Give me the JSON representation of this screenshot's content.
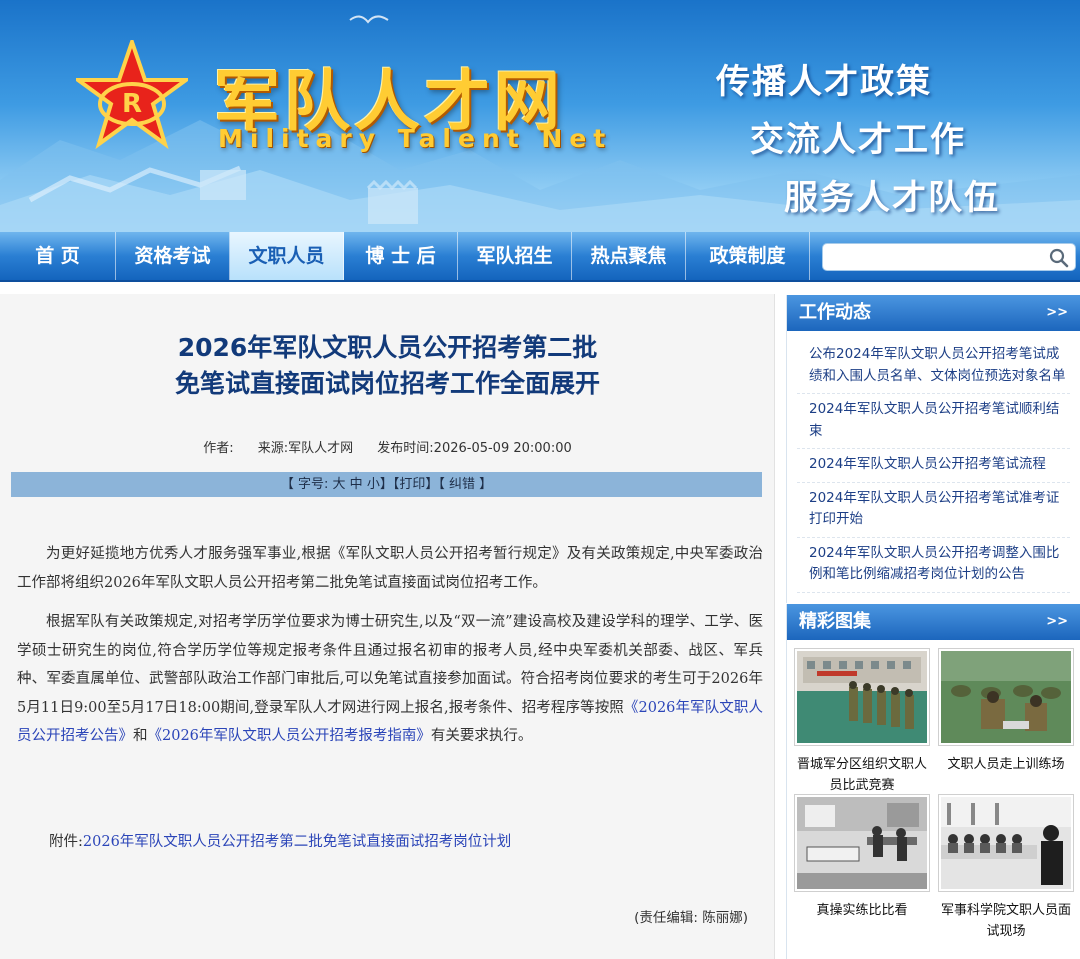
{
  "header": {
    "site_title": "军队人才网",
    "site_subtitle": "Military Talent Net",
    "slogans": [
      "传播人才政策",
      "交流人才工作",
      "服务人才队伍"
    ],
    "colors": {
      "banner": "#3e9be3",
      "title_gold": "#ffcc33",
      "nav": "#2a7fd3",
      "active_tab": "#b9e1fb"
    }
  },
  "nav": {
    "items": [
      {
        "label": "首  页"
      },
      {
        "label": "资格考试"
      },
      {
        "label": "文职人员"
      },
      {
        "label": "博 士 后"
      },
      {
        "label": "军队招生"
      },
      {
        "label": "热点聚焦"
      },
      {
        "label": "政策制度"
      }
    ],
    "active": "文职人员",
    "search": {
      "value": "",
      "placeholder": "",
      "icon": "search-icon"
    }
  },
  "article": {
    "title_line1": "2026年军队文职人员公开招考第二批",
    "title_line2": "免笔试直接面试岗位招考工作全面展开",
    "author_label": "作者:",
    "source": "来源:军队人才网",
    "publish_time": "发布时间:2026-05-09 20:00:00",
    "toolbar": {
      "font_label": "【 字号: ",
      "size_big": "大",
      "size_mid": "中",
      "size_small": "小",
      "font_close": "】",
      "print": "【打印】",
      "correct": "【 纠错 】"
    },
    "p1": "为更好延揽地方优秀人才服务强军事业,根据《军队文职人员公开招考暂行规定》及有关政策规定,中央军委政治工作部将组织2026年军队文职人员公开招考第二批免笔试直接面试岗位招考工作。",
    "p2_text": "根据军队有关政策规定,对招考学历学位要求为博士研究生,以及“双一流”建设高校及建设学科的理学、工学、医学硕士研究生的岗位,符合学历学位等规定报考条件且通过报名初审的报考人员,经中央军委机关部委、战区、军兵种、军委直属单位、武警部队政治工作部门审批后,可以免笔试直接参加面试。符合招考岗位要求的考生可于2026年5月11日9:00至5月17日18:00期间,登录军队人才网进行网上报名,报考条件、招考程序等按照",
    "p2_link1": "《2026年军队文职人员公开招考公告》",
    "p2_and": "和",
    "p2_link2": "《2026年军队文职人员公开招考报考指南》",
    "p2_tail": "有关要求执行。",
    "attach_label": "附件:",
    "attach_link": "2026年军队文职人员公开招考第二批免笔试直接面试招考岗位计划",
    "editor": "(责任编辑: 陈丽娜)"
  },
  "sidebar": {
    "news": {
      "title": "工作动态",
      "more": ">>",
      "items": [
        "公布2024年军队文职人员公开招考笔试成绩和入围人员名单、文体岗位预选对象名单",
        "2024年军队文职人员公开招考笔试顺利结束",
        "2024年军队文职人员公开招考笔试流程",
        "2024年军队文职人员公开招考笔试准考证打印开始",
        "2024年军队文职人员公开招考调整入围比例和笔比例缩减招考岗位计划的公告"
      ]
    },
    "gallery": {
      "title": "精彩图集",
      "more": ">>",
      "items": [
        {
          "caption": "晋城军分区组织文职人员比武竞赛"
        },
        {
          "caption": "文职人员走上训练场"
        },
        {
          "caption": "真操实练比比看"
        },
        {
          "caption": "军事科学院文职人员面试现场"
        }
      ]
    }
  }
}
